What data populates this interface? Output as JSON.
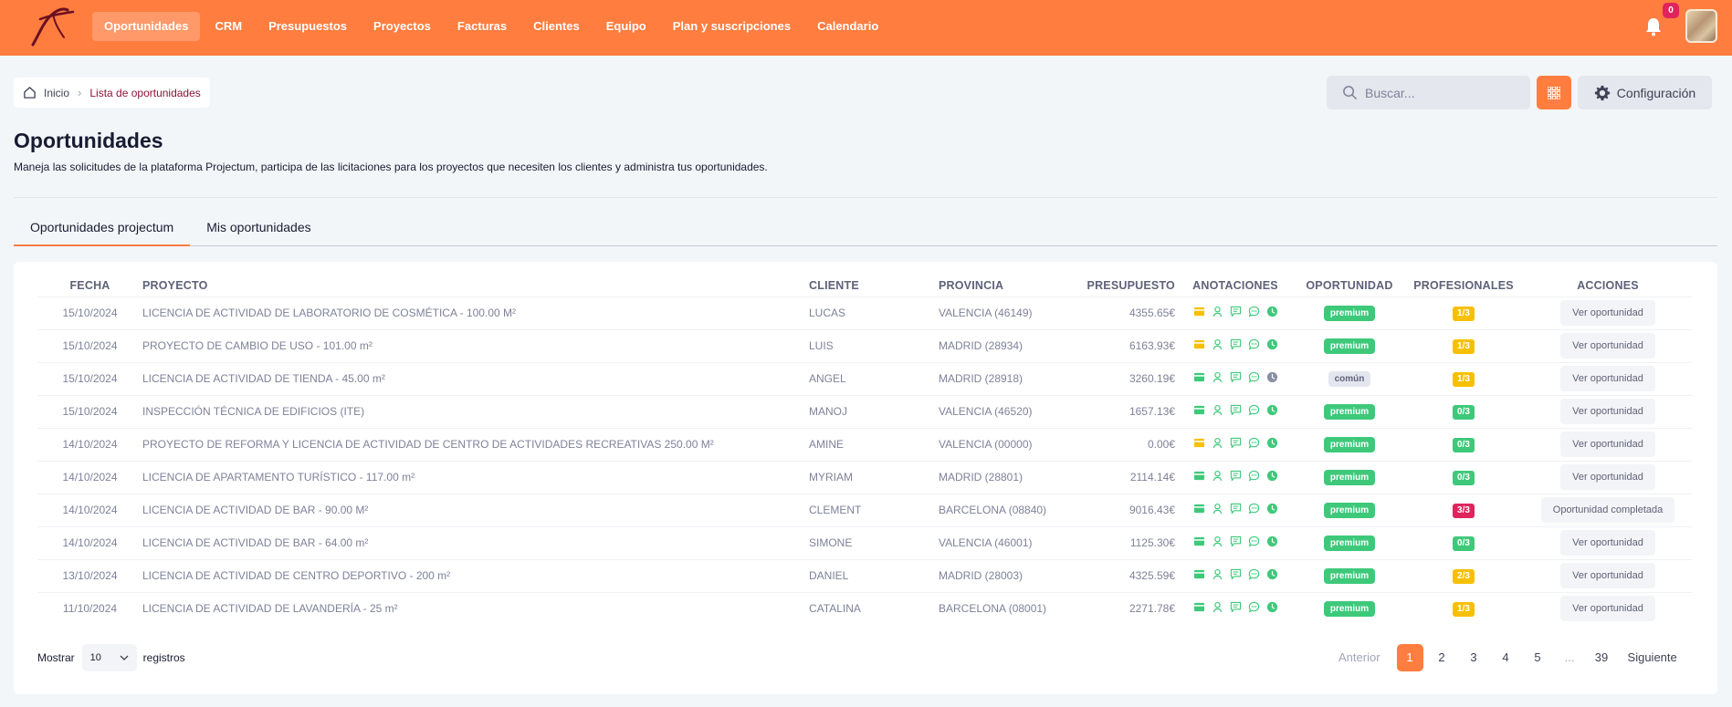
{
  "nav": {
    "items": [
      {
        "label": "Oportunidades",
        "active": true
      },
      {
        "label": "CRM"
      },
      {
        "label": "Presupuestos"
      },
      {
        "label": "Proyectos"
      },
      {
        "label": "Facturas"
      },
      {
        "label": "Clientes"
      },
      {
        "label": "Equipo"
      },
      {
        "label": "Plan y suscripciones"
      },
      {
        "label": "Calendario"
      }
    ],
    "notification_count": "0"
  },
  "breadcrumb": {
    "home": "Inicio",
    "current": "Lista de oportunidades"
  },
  "search": {
    "placeholder": "Buscar..."
  },
  "config_label": "Configuración",
  "page": {
    "title": "Oportunidades",
    "description": "Maneja las solicitudes de la plataforma Projectum, participa de las licitaciones para los proyectos que necesiten los clientes y administra tus oportunidades."
  },
  "tabs": [
    {
      "label": "Oportunidades projectum",
      "active": true
    },
    {
      "label": "Mis oportunidades"
    }
  ],
  "table": {
    "headers": [
      "FECHA",
      "PROYECTO",
      "CLIENTE",
      "PROVINCIA",
      "PRESUPUESTO",
      "ANOTACIONES",
      "OPORTUNIDAD",
      "PROFESIONALES",
      "ACCIONES"
    ],
    "rows": [
      {
        "fecha": "15/10/2024",
        "proyecto": "LICENCIA DE ACTIVIDAD DE LABORATORIO DE COSMÉTICA - 100.00 M²",
        "cliente": "LUCAS",
        "provincia": "VALENCIA (46149)",
        "presupuesto": "4355.65€",
        "budget_icon": "yellow",
        "clock_icon": "green",
        "oportunidad": "premium",
        "profesionales": "1/3",
        "prof_color": "yellow",
        "accion": "Ver oportunidad"
      },
      {
        "fecha": "15/10/2024",
        "proyecto": "PROYECTO DE CAMBIO DE USO - 101.00 m²",
        "cliente": "LUIS",
        "provincia": "MADRID (28934)",
        "presupuesto": "6163.93€",
        "budget_icon": "yellow",
        "clock_icon": "green",
        "oportunidad": "premium",
        "profesionales": "1/3",
        "prof_color": "yellow",
        "accion": "Ver oportunidad"
      },
      {
        "fecha": "15/10/2024",
        "proyecto": "LICENCIA DE ACTIVIDAD DE TIENDA - 45.00 m²",
        "cliente": "ANGEL",
        "provincia": "MADRID (28918)",
        "presupuesto": "3260.19€",
        "budget_icon": "green",
        "clock_icon": "gray",
        "oportunidad": "común",
        "profesionales": "1/3",
        "prof_color": "yellow",
        "accion": "Ver oportunidad"
      },
      {
        "fecha": "15/10/2024",
        "proyecto": "INSPECCIÓN TÉCNICA DE EDIFICIOS (ITE)",
        "cliente": "MANOJ",
        "provincia": "VALENCIA (46520)",
        "presupuesto": "1657.13€",
        "budget_icon": "green",
        "clock_icon": "green",
        "oportunidad": "premium",
        "profesionales": "0/3",
        "prof_color": "green",
        "accion": "Ver oportunidad"
      },
      {
        "fecha": "14/10/2024",
        "proyecto": "PROYECTO DE REFORMA Y LICENCIA DE ACTIVIDAD DE CENTRO DE ACTIVIDADES RECREATIVAS 250.00 M²",
        "cliente": "AMINE",
        "provincia": "VALENCIA (00000)",
        "presupuesto": "0.00€",
        "budget_icon": "yellow",
        "clock_icon": "green",
        "oportunidad": "premium",
        "profesionales": "0/3",
        "prof_color": "green",
        "accion": "Ver oportunidad"
      },
      {
        "fecha": "14/10/2024",
        "proyecto": "LICENCIA DE APARTAMENTO TURÍSTICO - 117.00 m²",
        "cliente": "MYRIAM",
        "provincia": "MADRID (28801)",
        "presupuesto": "2114.14€",
        "budget_icon": "green",
        "clock_icon": "green",
        "oportunidad": "premium",
        "profesionales": "0/3",
        "prof_color": "green",
        "accion": "Ver oportunidad"
      },
      {
        "fecha": "14/10/2024",
        "proyecto": "LICENCIA DE ACTIVIDAD DE BAR - 90.00 M²",
        "cliente": "CLEMENT",
        "provincia": "BARCELONA (08840)",
        "presupuesto": "9016.43€",
        "budget_icon": "green",
        "clock_icon": "green",
        "oportunidad": "premium",
        "profesionales": "3/3",
        "prof_color": "red",
        "accion": "Oportunidad completada"
      },
      {
        "fecha": "14/10/2024",
        "proyecto": "LICENCIA DE ACTIVIDAD DE BAR - 64.00 m²",
        "cliente": "SIMONE",
        "provincia": "VALENCIA (46001)",
        "presupuesto": "1125.30€",
        "budget_icon": "green",
        "clock_icon": "green",
        "oportunidad": "premium",
        "profesionales": "0/3",
        "prof_color": "green",
        "accion": "Ver oportunidad"
      },
      {
        "fecha": "13/10/2024",
        "proyecto": "LICENCIA DE ACTIVIDAD DE CENTRO DEPORTIVO - 200 m²",
        "cliente": "DANIEL",
        "provincia": "MADRID (28003)",
        "presupuesto": "4325.59€",
        "budget_icon": "green",
        "clock_icon": "green",
        "oportunidad": "premium",
        "profesionales": "2/3",
        "prof_color": "yellow",
        "accion": "Ver oportunidad"
      },
      {
        "fecha": "11/10/2024",
        "proyecto": "LICENCIA DE ACTIVIDAD DE LAVANDERÍA - 25 m²",
        "cliente": "CATALINA",
        "provincia": "BARCELONA (08001)",
        "presupuesto": "2271.78€",
        "budget_icon": "green",
        "clock_icon": "green",
        "oportunidad": "premium",
        "profesionales": "1/3",
        "prof_color": "yellow",
        "accion": "Ver oportunidad"
      }
    ]
  },
  "footer": {
    "show_label": "Mostrar",
    "page_size": "10",
    "records_label": "registros",
    "pager": {
      "prev": "Anterior",
      "pages": [
        "1",
        "2",
        "3",
        "4",
        "5",
        "...",
        "39"
      ],
      "active": "1",
      "next": "Siguiente"
    }
  },
  "colors": {
    "accent": "#ff7d3f",
    "premium": "#3ec97a",
    "yellow": "#f6c000",
    "red": "#e0245e",
    "icon_green": "#3ec97a",
    "icon_gray": "#8a8fa3"
  }
}
